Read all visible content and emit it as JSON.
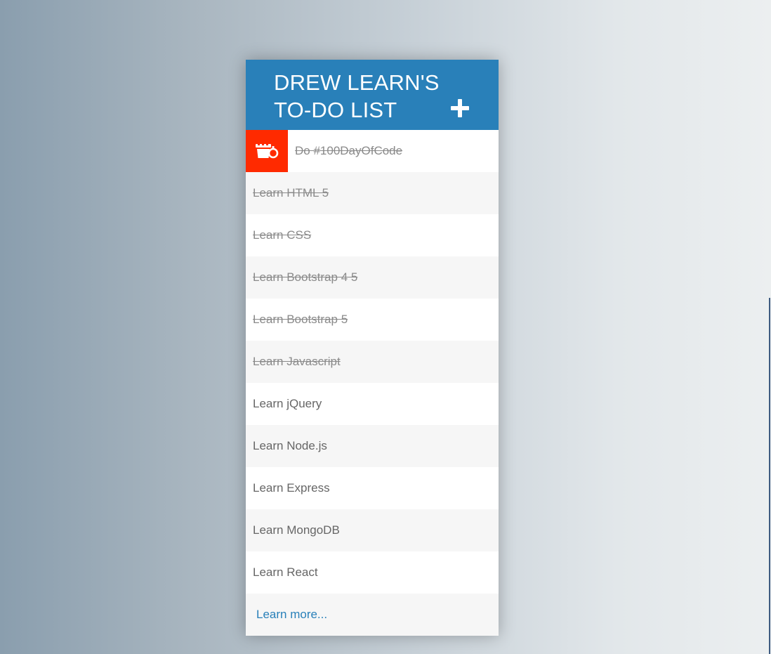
{
  "header": {
    "title_line1": "DREW LEARN'S",
    "title_line2": "TO-DO LIST"
  },
  "colors": {
    "header_bg": "#2980b9",
    "delete_bg": "#ff2a00",
    "link": "#2980b9"
  },
  "icons": {
    "add": "plus-icon",
    "delete": "trash-icon"
  },
  "todos": [
    {
      "label": "Do #100DayOfCode",
      "done": true,
      "hovered": true
    },
    {
      "label": "Learn HTML 5",
      "done": true
    },
    {
      "label": "Learn CSS",
      "done": true
    },
    {
      "label": "Learn Bootstrap 4 5",
      "done": true
    },
    {
      "label": "Learn Bootstrap 5",
      "done": true
    },
    {
      "label": "Learn Javascript",
      "done": true
    },
    {
      "label": "Learn jQuery",
      "done": false
    },
    {
      "label": "Learn Node.js",
      "done": false
    },
    {
      "label": "Learn Express",
      "done": false
    },
    {
      "label": "Learn MongoDB",
      "done": false
    },
    {
      "label": "Learn React",
      "done": false
    }
  ],
  "footer": {
    "link_text": "Learn more..."
  }
}
